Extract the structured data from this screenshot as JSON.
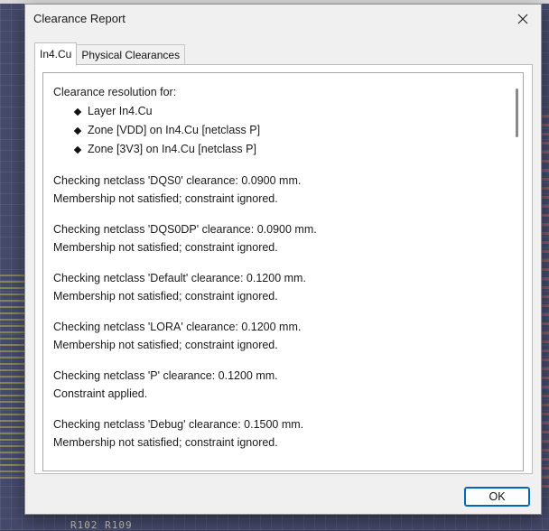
{
  "dialog": {
    "title": "Clearance Report",
    "ok_label": "OK"
  },
  "tabs": [
    {
      "label": "In4.Cu",
      "active": true
    },
    {
      "label": "Physical Clearances",
      "active": false
    }
  ],
  "report": {
    "heading": "Clearance resolution for:",
    "items": [
      "Layer In4.Cu",
      "Zone [VDD] on In4.Cu [netclass P]",
      "Zone [3V3] on In4.Cu [netclass P]"
    ],
    "checks": [
      {
        "line1": "Checking netclass 'DQS0' clearance: 0.0900 mm.",
        "line2": "Membership not satisfied; constraint ignored."
      },
      {
        "line1": "Checking netclass 'DQS0DP' clearance: 0.0900 mm.",
        "line2": "Membership not satisfied; constraint ignored."
      },
      {
        "line1": "Checking netclass 'Default' clearance: 0.1200 mm.",
        "line2": "Membership not satisfied; constraint ignored."
      },
      {
        "line1": "Checking netclass 'LORA' clearance: 0.1200 mm.",
        "line2": "Membership not satisfied; constraint ignored."
      },
      {
        "line1": "Checking netclass 'P' clearance: 0.1200 mm.",
        "line2": "Constraint applied."
      },
      {
        "line1": "Checking netclass 'Debug' clearance: 0.1500 mm.",
        "line2": "Membership not satisfied; constraint ignored."
      }
    ]
  },
  "background": {
    "board_label": "R102 R109"
  },
  "colors": {
    "accent": "#0067c0",
    "dialog_bg": "#f0f0f0"
  }
}
